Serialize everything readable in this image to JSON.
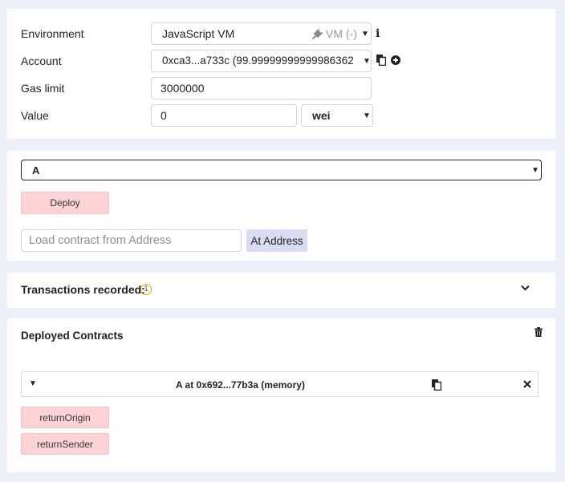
{
  "settings": {
    "environment_label": "Environment",
    "environment_value": "JavaScript VM",
    "environment_vm": "VM (-)",
    "account_label": "Account",
    "account_value": "0xca3...a733c (99.99999999999986362",
    "gas_label": "Gas limit",
    "gas_value": "3000000",
    "value_label": "Value",
    "value_value": "0",
    "unit_value": "wei"
  },
  "deploy": {
    "contract_selected": "A",
    "deploy_label": "Deploy",
    "address_placeholder": "Load contract from Address",
    "at_address_label": "At Address"
  },
  "transactions": {
    "title": "Transactions recorded:",
    "count": "1"
  },
  "deployed": {
    "title": "Deployed Contracts",
    "instance_label": "A at 0x692...77b3a (memory)",
    "functions": [
      "returnOrigin",
      "returnSender"
    ]
  }
}
